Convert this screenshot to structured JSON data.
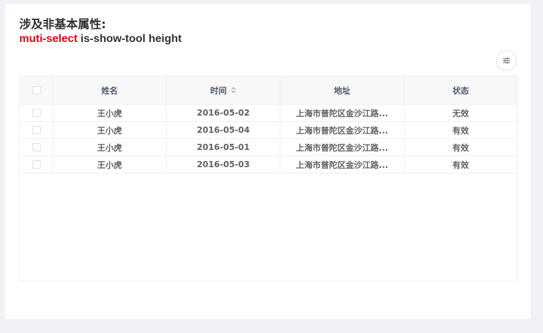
{
  "title": {
    "line1": "涉及非基本属性:",
    "line2_accent": "muti-select",
    "line2_rest": " is-show-tool height"
  },
  "table": {
    "columns": [
      "姓名",
      "时间",
      "地址",
      "状态"
    ],
    "rows": [
      {
        "name": "王小虎",
        "time": "2016-05-02",
        "address": "上海市普陀区金沙江路...",
        "status": "无效"
      },
      {
        "name": "王小虎",
        "time": "2016-05-04",
        "address": "上海市普陀区金沙江路...",
        "status": "有效"
      },
      {
        "name": "王小虎",
        "time": "2016-05-01",
        "address": "上海市普陀区金沙江路...",
        "status": "有效"
      },
      {
        "name": "王小虎",
        "time": "2016-05-03",
        "address": "上海市普陀区金沙江路...",
        "status": "有效"
      }
    ]
  },
  "icons": {
    "tool": "sliders-icon",
    "sort": "sort-caret-icon"
  },
  "colors": {
    "accent": "#e60012",
    "title": "#303133"
  }
}
